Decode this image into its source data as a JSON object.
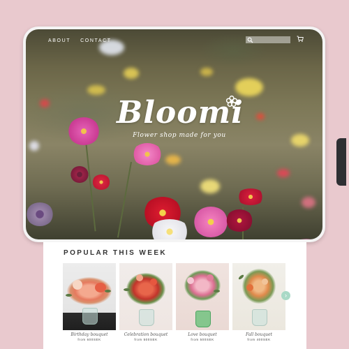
{
  "nav": {
    "about": "ABOUT",
    "contact": "CONTACT",
    "search_placeholder": "",
    "search_icon": "search-icon",
    "cart_icon": "cart-icon"
  },
  "hero": {
    "logo": "Bloomi",
    "tagline": "Flower shop made for you"
  },
  "popular": {
    "title": "POPULAR THIS WEEK",
    "products": [
      {
        "name": "Birthday bouquet",
        "price": "from 600SEK"
      },
      {
        "name": "Celebration bouquet",
        "price": "from 500SEK"
      },
      {
        "name": "Love bouquet",
        "price": "from 500SEK"
      },
      {
        "name": "Fall bouquet",
        "price": "from 400SEK"
      }
    ],
    "next_arrow": "›"
  },
  "colors": {
    "background": "#e9c9ce",
    "accent": "#a9d9c6"
  }
}
